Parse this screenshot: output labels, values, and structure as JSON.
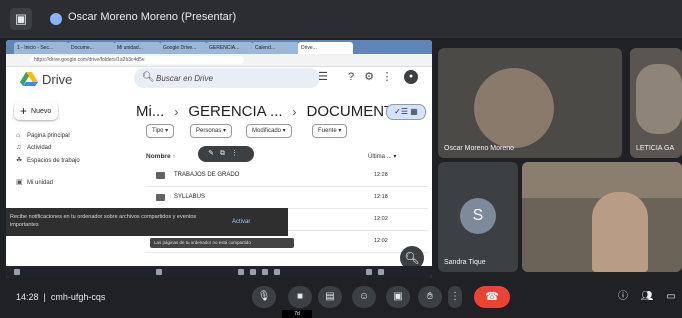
{
  "meet": {
    "presenter_title": "Oscar Moreno Moreno (Presentar)",
    "meeting_time": "14:28",
    "meeting_code": "cmh-ufgh-cqs",
    "mic_tooltip": "7d"
  },
  "participants": [
    {
      "name": "Oscar Moreno Moreno"
    },
    {
      "name": "LETICIA GA"
    },
    {
      "name": "Sandra Tique",
      "initial": "S"
    },
    {
      "name": ""
    }
  ],
  "browser": {
    "tabs": [
      "1 - Inicio - Sec...",
      "Docume...",
      "Mi unidad...",
      "Google Drive...",
      "GERENCIA...",
      "Calend...",
      "Drive..."
    ],
    "url": "https://drive.google.com/drive/folders/1a2b3c4d5e"
  },
  "drive": {
    "app_name": "Drive",
    "search_placeholder": "Buscar en Drive",
    "new_button": "Nuevo",
    "sidebar": [
      "Página principal",
      "Actividad",
      "Espacios de trabajo",
      "Mi unidad"
    ],
    "breadcrumb": [
      "Mi...",
      "GERENCIA ...",
      "DOCUMENTO..."
    ],
    "filters": [
      "Tipo",
      "Personas",
      "Modificado",
      "Fuente"
    ],
    "columns": {
      "name": "Nombre",
      "updated": "Última ..."
    },
    "rows": [
      {
        "name": "TRABAJOS DE GRADO",
        "date": "12:28"
      },
      {
        "name": "SYLLABUS",
        "date": "12:18"
      },
      {
        "name": "",
        "date": "12:02"
      },
      {
        "name": "",
        "date": "12:02"
      }
    ],
    "notification": {
      "text": "Recibe notificaciones en tu ordenador sobre archivos compartidos y eventos importantes",
      "button": "Activar"
    },
    "notification2": "Las páginas de tu ordenador no está compartido"
  },
  "colors": {
    "meet_bg": "#202124",
    "end_call": "#ea4335",
    "drive_search": "#e9eef6",
    "tab_bar": "#5f86b7"
  },
  "icons": {
    "controls": [
      "mic-icon",
      "camera-icon",
      "captions-icon",
      "emoji-icon",
      "present-icon",
      "raise-hand-icon",
      "more-icon",
      "end-call-icon"
    ],
    "right": [
      "info-icon",
      "people-icon",
      "chat-icon"
    ]
  }
}
